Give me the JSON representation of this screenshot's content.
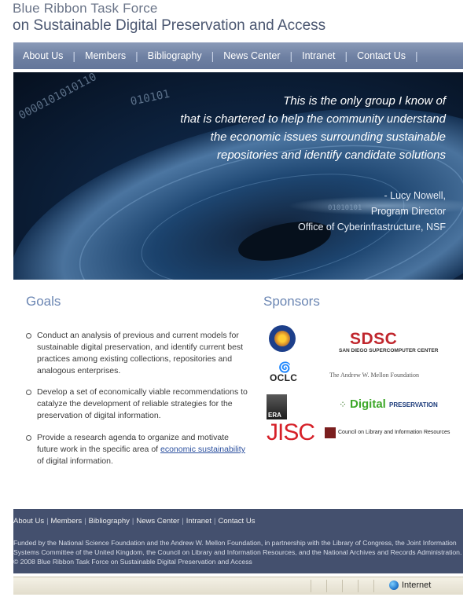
{
  "header": {
    "title_line1": "Blue Ribbon Task Force",
    "title_line2": "on Sustainable Digital Preservation and Access"
  },
  "nav": {
    "items": [
      "About Us",
      "Members",
      "Bibliography",
      "News Center",
      "Intranet",
      "Contact Us"
    ]
  },
  "hero": {
    "quote": [
      "This is the only group I know of",
      "that is chartered to help the community understand",
      "the economic issues surrounding sustainable",
      "repositories and identify candidate solutions"
    ],
    "attribution": [
      "- Lucy Nowell,",
      "Program Director",
      "Office of Cyberinfrastructure, NSF"
    ],
    "binary_text": [
      "0000101010110",
      "010101",
      "01010101"
    ]
  },
  "goals": {
    "title": "Goals",
    "items": [
      {
        "text": "Conduct an analysis of previous and current models for sustainable digital preservation, and identify current best practices among existing collections, repositories and analogous enterprises."
      },
      {
        "text": "Develop a set of economically viable recommendations to catalyze the development of reliable strategies for the preservation of digital information."
      },
      {
        "before": "Provide a research agenda to organize and motivate future work in the specific area of ",
        "link": "economic sustainability",
        "after": " of digital information."
      }
    ]
  },
  "sponsors": {
    "title": "Sponsors",
    "sdsc": "SDSC",
    "sdsc_sub": "SAN DIEGO SUPERCOMPUTER CENTER",
    "oclc": "OCLC",
    "mellon": "The Andrew W. Mellon Foundation",
    "era": "ERA",
    "digital_preservation": "Digital",
    "digital_preservation_2": "PRESERVATION",
    "jisc": "JISC",
    "clir": "Council on Library and Information Resources"
  },
  "footer": {
    "nav": [
      "About Us",
      "Members",
      "Bibliography",
      "News Center",
      "Intranet",
      "Contact Us"
    ],
    "funding_lines": [
      "Funded by the National Science Foundation and the Andrew W. Mellon Foundation, in partnership with the Library of Congress, the Joint Information",
      "Systems Committee of the United Kingdom, the Council on Library and Information Resources, and the National Archives and Records Administration."
    ],
    "copyright": "© 2008 Blue Ribbon Task Force on Sustainable Digital Preservation and Access"
  },
  "statusbar": {
    "zone": "Internet"
  },
  "colors": {
    "nav_bg": "#6e80a2",
    "heading": "#6b86b3",
    "footer_bg": "#44506e",
    "link": "#2a4f9e"
  }
}
